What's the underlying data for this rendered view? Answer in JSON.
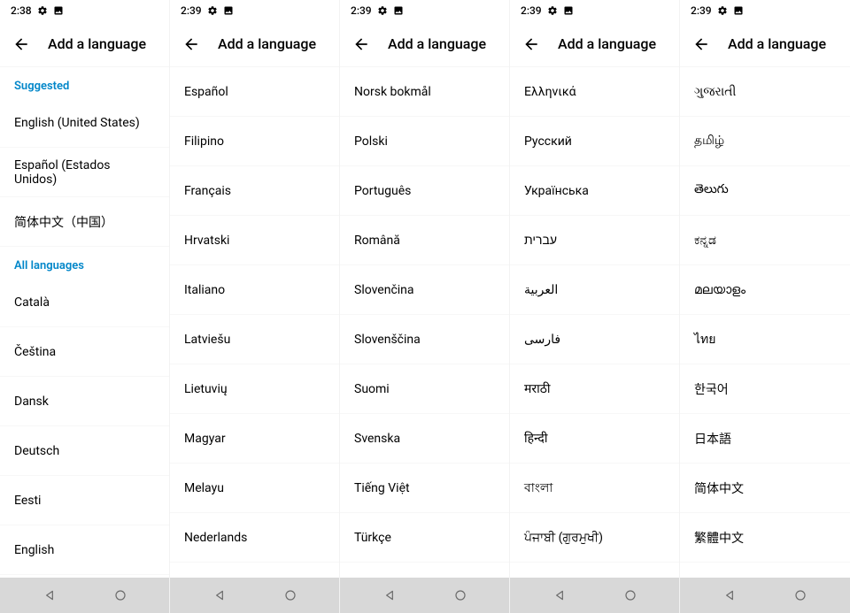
{
  "screens": [
    {
      "status": {
        "time": "2:38"
      },
      "title": "Add a language",
      "sections": [
        {
          "header": "Suggested",
          "items": [
            "English (United States)",
            "Español (Estados Unidos)",
            "简体中文（中国）"
          ]
        },
        {
          "header": "All languages",
          "items": [
            "Català",
            "Čeština",
            "Dansk",
            "Deutsch",
            "Eesti",
            "English"
          ]
        }
      ]
    },
    {
      "status": {
        "time": "2:39"
      },
      "title": "Add a language",
      "sections": [
        {
          "header": null,
          "items": [
            "Español",
            "Filipino",
            "Français",
            "Hrvatski",
            "Italiano",
            "Latviešu",
            "Lietuvių",
            "Magyar",
            "Melayu",
            "Nederlands"
          ]
        }
      ]
    },
    {
      "status": {
        "time": "2:39"
      },
      "title": "Add a language",
      "sections": [
        {
          "header": null,
          "items": [
            "Norsk bokmål",
            "Polski",
            "Português",
            "Română",
            "Slovenčina",
            "Slovenščina",
            "Suomi",
            "Svenska",
            "Tiếng Việt",
            "Türkçe"
          ]
        }
      ]
    },
    {
      "status": {
        "time": "2:39"
      },
      "title": "Add a language",
      "sections": [
        {
          "header": null,
          "items": [
            "Ελληνικά",
            "Русский",
            "Українська",
            "עברית",
            "العربية",
            "فارسی",
            "मराठी",
            "हिन्दी",
            "বাংলা",
            "ਪੰਜਾਬੀ (ਗੁਰਮੁਖੀ)"
          ]
        }
      ]
    },
    {
      "status": {
        "time": "2:39"
      },
      "title": "Add a language",
      "sections": [
        {
          "header": null,
          "items": [
            "ગુજરાતી",
            "தமிழ்",
            "తెలుగు",
            "ಕನ್ನಡ",
            "മലയാളം",
            "ไทย",
            "한국어",
            "日本語",
            "简体中文",
            "繁體中文"
          ]
        }
      ]
    }
  ]
}
